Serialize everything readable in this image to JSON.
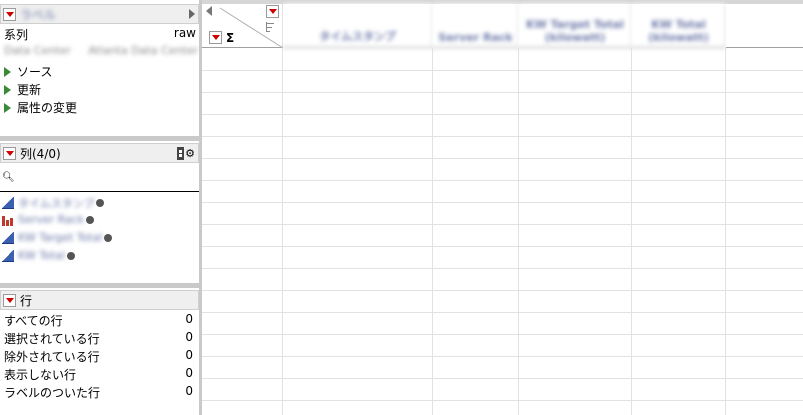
{
  "table_panel": {
    "title": "ラベル",
    "series_label": "系列",
    "series_value": "raw",
    "subtitle_left": "Data Center",
    "subtitle_right": "Atlanta Data Center",
    "scripts": [
      "ソース",
      "更新",
      "属性の変更"
    ]
  },
  "columns_panel": {
    "title": "列(4/0)",
    "search_placeholder": "",
    "items": [
      {
        "name": "タイムスタンプ",
        "type": "continuous"
      },
      {
        "name": "Server Rack",
        "type": "nominal"
      },
      {
        "name": "KW Target Total",
        "type": "continuous"
      },
      {
        "name": "KW Total",
        "type": "continuous"
      }
    ]
  },
  "rows_panel": {
    "title": "行",
    "items": [
      {
        "label": "すべての行",
        "value": "0"
      },
      {
        "label": "選択されている行",
        "value": "0"
      },
      {
        "label": "除外されている行",
        "value": "0"
      },
      {
        "label": "表示しない行",
        "value": "0"
      },
      {
        "label": "ラベルのついた行",
        "value": "0"
      }
    ]
  },
  "grid": {
    "sigma": "Σ",
    "headers": [
      "タイムスタンプ",
      "Server Rack",
      "KW Target Total (kilowatt)",
      "KW Total (kilowatt)"
    ]
  },
  "colors": {
    "dropdown_arrow": "#cc0000",
    "script_triangle": "#3a8a3a",
    "continuous_icon": "#3a5fb0",
    "nominal_icon": "#c0392b"
  }
}
